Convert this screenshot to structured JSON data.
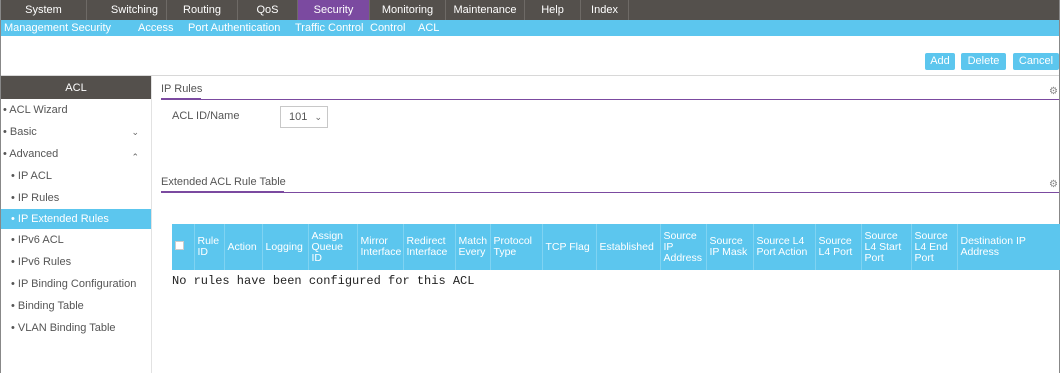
{
  "top_nav": [
    {
      "label": "System"
    },
    {
      "label": "Switching"
    },
    {
      "label": "Routing"
    },
    {
      "label": "QoS"
    },
    {
      "label": "Security"
    },
    {
      "label": "Monitoring"
    },
    {
      "label": "Maintenance"
    },
    {
      "label": "Help"
    },
    {
      "label": "Index"
    }
  ],
  "sub_nav": [
    {
      "label": "Management Security"
    },
    {
      "label": "Access"
    },
    {
      "label": "Port Authentication"
    },
    {
      "label": "Traffic Control"
    },
    {
      "label": "Control"
    },
    {
      "label": "ACL"
    }
  ],
  "toolbar": {
    "add_label": "Add",
    "delete_label": "Delete",
    "cancel_label": "Cancel"
  },
  "sidebar": {
    "header": "ACL",
    "items": [
      {
        "label": "• ACL Wizard"
      },
      {
        "label": "• Basic",
        "chevron": "⌄"
      },
      {
        "label": "• Advanced",
        "chevron": "⌃"
      },
      {
        "label": "• IP ACL"
      },
      {
        "label": "• IP Rules"
      },
      {
        "label": "• IP Extended Rules"
      },
      {
        "label": "• IPv6 ACL"
      },
      {
        "label": "• IPv6 Rules"
      },
      {
        "label": "• IP Binding Configuration"
      },
      {
        "label": "• Binding Table"
      },
      {
        "label": "• VLAN Binding Table"
      }
    ]
  },
  "ip_rules": {
    "title": "IP Rules",
    "acl_label": "ACL ID/Name",
    "acl_value": "101"
  },
  "rule_table": {
    "title": "Extended ACL Rule Table",
    "columns": [
      {
        "label": ""
      },
      {
        "label": "Rule ID"
      },
      {
        "label": "Action"
      },
      {
        "label": "Logging"
      },
      {
        "label": "Assign Queue ID"
      },
      {
        "label": "Mirror Interface"
      },
      {
        "label": "Redirect Interface"
      },
      {
        "label": "Match Every"
      },
      {
        "label": "Protocol Type"
      },
      {
        "label": "TCP Flag"
      },
      {
        "label": "Established"
      },
      {
        "label": "Source IP Address"
      },
      {
        "label": "Source IP Mask"
      },
      {
        "label": "Source L4 Port Action"
      },
      {
        "label": "Source L4 Port"
      },
      {
        "label": "Source L4 Start Port"
      },
      {
        "label": "Source L4 End Port"
      },
      {
        "label": "Destination IP Address"
      }
    ],
    "empty_message": "No rules have been configured for this ACL"
  },
  "colors": {
    "accent": "#5cc6ee",
    "active_tab": "#7b4aa0",
    "nav_bg": "#54504c"
  }
}
